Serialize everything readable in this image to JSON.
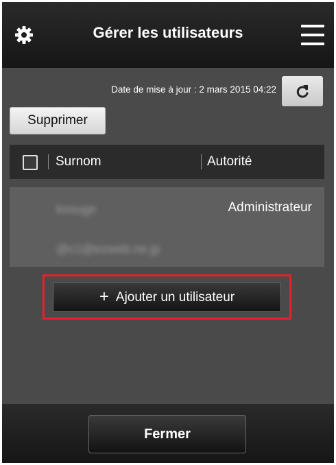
{
  "header": {
    "title": "Gérer les utilisateurs",
    "settings_icon": "gear-icon",
    "menu_icon": "hamburger-menu-icon"
  },
  "update": {
    "text": "Date de mise à jour : 2 mars 2015 04:22",
    "refresh_icon": "refresh-icon"
  },
  "toolbar": {
    "delete_label": "Supprimer"
  },
  "table": {
    "columns": [
      "Surnom",
      "Autorité"
    ],
    "rows": [
      {
        "nickname": "kosuge",
        "email": "@c1@ezweb.ne.jp",
        "role": "Administrateur"
      }
    ]
  },
  "actions": {
    "add_user_label": "Ajouter un utilisateur",
    "add_icon": "+",
    "highlight_color": "#e8202a"
  },
  "footer": {
    "close_label": "Fermer"
  }
}
